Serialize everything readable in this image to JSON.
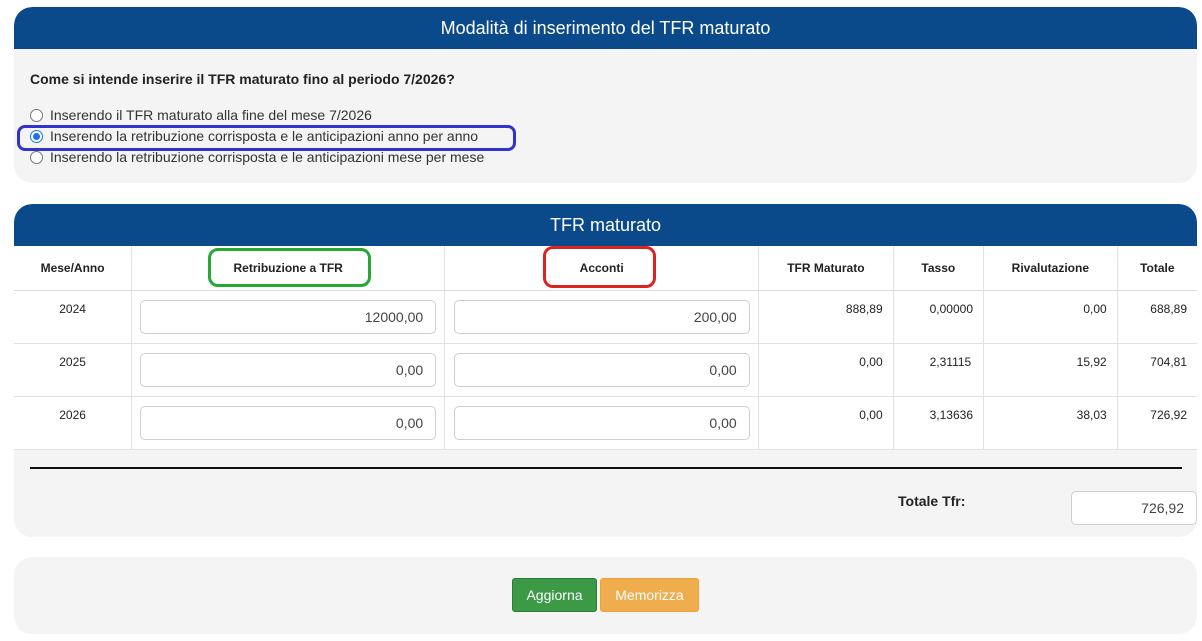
{
  "mode_panel": {
    "title": "Modalità di inserimento del TFR maturato",
    "question": "Come si intende inserire il TFR maturato fino al periodo 7/2026?",
    "options": [
      {
        "label": "Inserendo il TFR maturato alla fine del mese 7/2026",
        "selected": false
      },
      {
        "label": "Inserendo la retribuzione corrisposta e le anticipazioni anno per anno",
        "selected": true
      },
      {
        "label": "Inserendo la retribuzione corrisposta e le anticipazioni mese per mese",
        "selected": false
      }
    ]
  },
  "tfr_panel": {
    "title": "TFR maturato",
    "columns": [
      "Mese/Anno",
      "Retribuzione a TFR",
      "Acconti",
      "TFR Maturato",
      "Tasso",
      "Rivalutazione",
      "Totale"
    ],
    "rows": [
      {
        "year": "2024",
        "retribuzione": "12000,00",
        "acconti": "200,00",
        "tfr_maturato": "888,89",
        "tasso": "0,00000",
        "rivalutazione": "0,00",
        "totale": "688,89"
      },
      {
        "year": "2025",
        "retribuzione": "0,00",
        "acconti": "0,00",
        "tfr_maturato": "0,00",
        "tasso": "2,31115",
        "rivalutazione": "15,92",
        "totale": "704,81"
      },
      {
        "year": "2026",
        "retribuzione": "0,00",
        "acconti": "0,00",
        "tfr_maturato": "0,00",
        "tasso": "3,13636",
        "rivalutazione": "38,03",
        "totale": "726,92"
      }
    ],
    "total_label": "Totale Tfr:",
    "total_value": "726,92"
  },
  "actions": {
    "update_label": "Aggiorna",
    "save_label": "Memorizza"
  },
  "colors": {
    "header": "#0a4a8a",
    "highlight_option": "#3333cc",
    "highlight_retribuzione": "#22aa33",
    "highlight_acconti": "#dd2222",
    "update_button": "#3c9a47",
    "save_button": "#f0ad4e"
  }
}
